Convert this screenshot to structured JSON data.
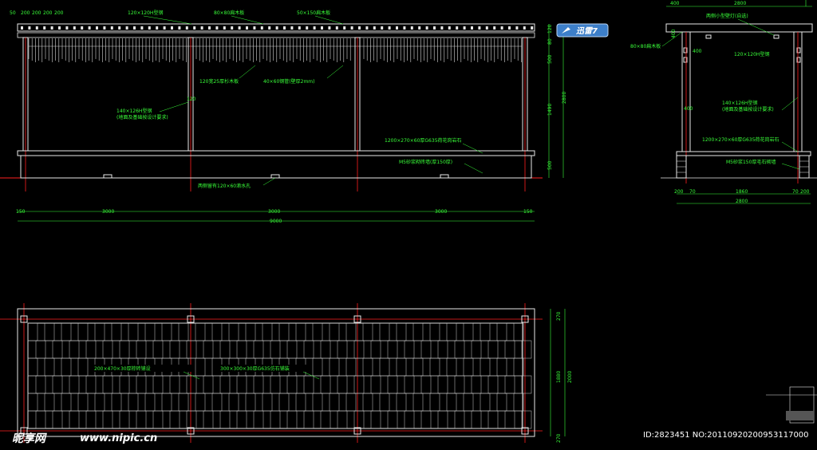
{
  "elevation": {
    "callouts": [
      "120×120H型钢",
      "80×80扁木板",
      "50×150扁木板",
      "140×126H型钢",
      "(地面及基础按设计要求)",
      "120宽25厚杉木板",
      "40×60钢管(壁厚2mm)",
      "1200×270×60厚G635荷花岗岩石",
      "M5砂浆砌砖墙(厚150厚)",
      "两侧留有120×60滴水孔"
    ],
    "side_dims": [
      "120",
      "80",
      "500",
      "1490",
      "2800",
      "500"
    ],
    "top_dims": [
      "50",
      "200",
      "200",
      "200",
      "200"
    ],
    "bottom_dims": [
      "150",
      "3000",
      "3000",
      "3000",
      "150"
    ],
    "total": "9000"
  },
  "side_view": {
    "top_dims": [
      "400",
      "2800"
    ],
    "callouts": [
      "两侧小型壁灯(自选)",
      "80×80扁木板",
      "120×120H型钢",
      "140×126H型钢",
      "(地面及基础按设计要求)",
      "1200×270×60厚G635荷花岗岩石",
      "M5砂浆150厚毛石砌墙"
    ],
    "left_dims": [
      "400",
      "400",
      "400"
    ],
    "bottom_dims": [
      "200",
      "70",
      "1860",
      "70",
      "200"
    ],
    "total": "2800"
  },
  "plan": {
    "callouts": [
      "200×470×30厚棕砖铺设",
      "300×300×30厚G635仿石铺装"
    ],
    "right_dims": [
      "270",
      "1880",
      "2000",
      "270"
    ]
  },
  "badge": {
    "label": "迅雷7"
  },
  "watermark": {
    "brand": "昵享网",
    "url": "www.nipic.cn",
    "id_line": "ID:2823451 NO:20110920200953117000"
  }
}
